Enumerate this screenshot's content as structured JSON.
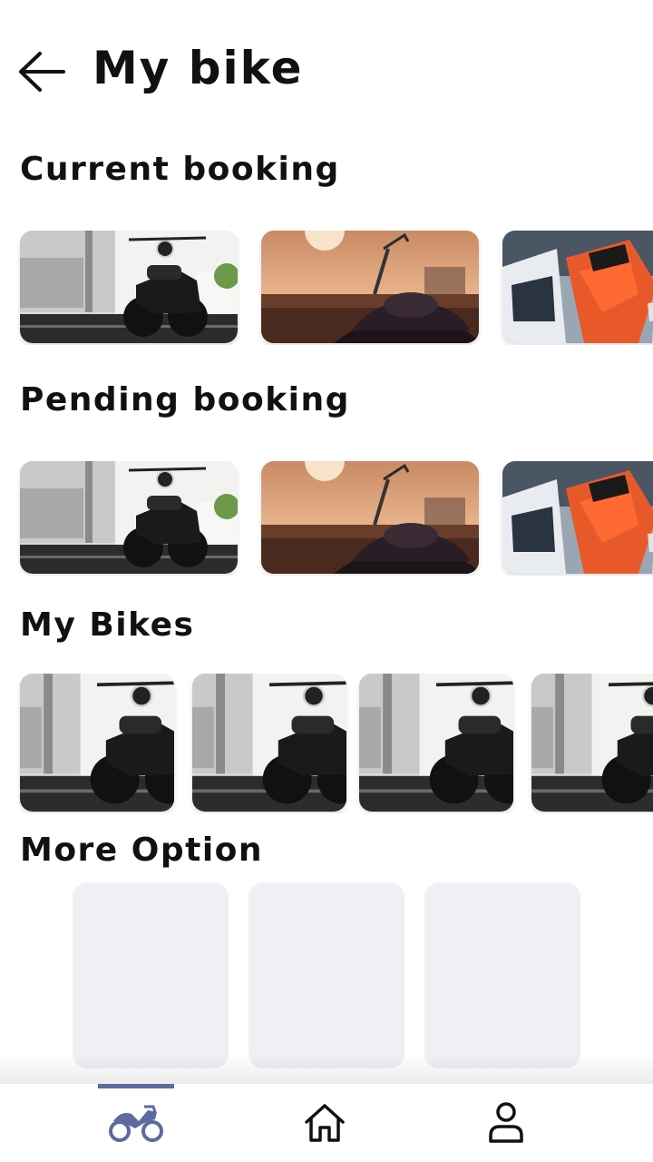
{
  "header": {
    "title": "My bike",
    "back_icon": "arrow-left-icon"
  },
  "sections": {
    "current": {
      "title": "Current booking"
    },
    "pending": {
      "title": "Pending booking"
    },
    "my_bikes": {
      "title": "My Bikes"
    },
    "more": {
      "title": "More Option"
    }
  },
  "photos": {
    "current": [
      "scrambler-motorcycle-photo",
      "cruiser-sunset-photo",
      "red-sportbike-photo"
    ],
    "pending": [
      "scrambler-motorcycle-photo",
      "cruiser-sunset-photo",
      "red-sportbike-photo"
    ],
    "my_bikes": [
      "scrambler-motorcycle-photo",
      "scrambler-motorcycle-photo",
      "scrambler-motorcycle-photo",
      "scrambler-motorcycle-photo"
    ]
  },
  "bottom_nav": {
    "items": [
      {
        "icon": "motorcycle-icon",
        "active": true
      },
      {
        "icon": "home-icon",
        "active": false
      },
      {
        "icon": "user-icon",
        "active": false
      }
    ]
  },
  "colors": {
    "accent": "#5c6aa0",
    "tile": "#eef0f4",
    "text": "#111111"
  }
}
